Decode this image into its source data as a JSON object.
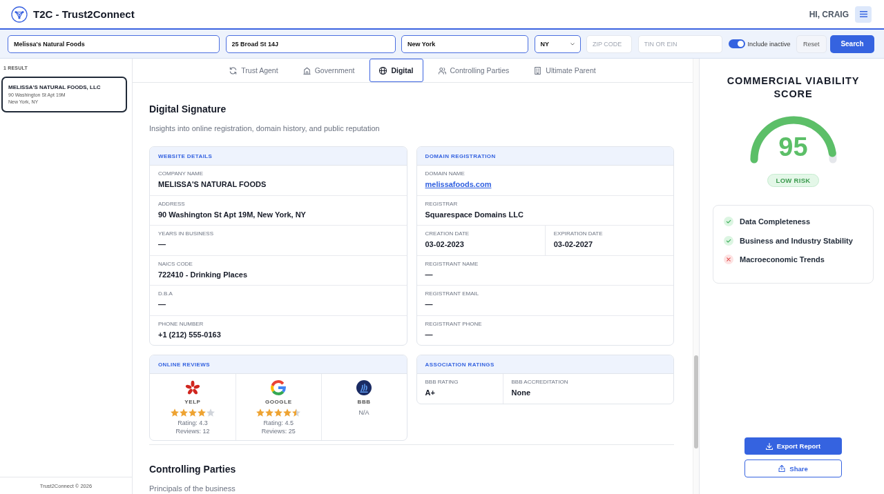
{
  "header": {
    "title": "T2C - Trust2Connect",
    "greeting": "HI, CRAIG"
  },
  "search_bar": {
    "fields": [
      {
        "kind": "text",
        "value": "Melissa's Natural Foods"
      },
      {
        "kind": "text",
        "value": "25 Broad St 14J"
      },
      {
        "kind": "text",
        "value": "New York"
      },
      {
        "kind": "select",
        "value": "NY"
      },
      {
        "kind": "text",
        "placeholder": "ZIP CODE"
      },
      {
        "kind": "text",
        "placeholder": "TIN OR EIN"
      }
    ],
    "include_inactive": {
      "label": "Include inactive",
      "on": true
    },
    "buttons": [
      "Reset",
      "Search"
    ]
  },
  "results": {
    "count": "1 RESULT",
    "items": [
      {
        "name": "MELISSA'S NATURAL FOODS, LLC",
        "address": "90 Washington St Apt 19M",
        "city": "New York, NY",
        "selected": true
      }
    ]
  },
  "footer": "Trust2Connect © 2026",
  "tabs": [
    {
      "label": "Trust Agent",
      "selected": false
    },
    {
      "label": "Government",
      "selected": false
    },
    {
      "label": "Digital",
      "selected": true
    },
    {
      "label": "Controlling Parties",
      "selected": false
    },
    {
      "label": "Ultimate Parent",
      "selected": false
    }
  ],
  "digital_signature": {
    "title": "Digital Signature",
    "subtitle": "Insights into online registration, domain history, and public reputation",
    "website_details": {
      "title": "WEBSITE DETAILS",
      "rows": [
        [
          {
            "kind": "text",
            "label": "COMPANY NAME",
            "value": "MELISSA'S NATURAL FOODS"
          }
        ],
        [
          {
            "kind": "text",
            "label": "ADDRESS",
            "value": "90 Washington St Apt 19M, New York, NY"
          }
        ],
        [
          {
            "kind": "text",
            "label": "YEARS IN BUSINESS",
            "value": "—"
          }
        ],
        [
          {
            "kind": "text",
            "label": "NAICS CODE",
            "value": "722410 - Drinking Places"
          }
        ],
        [
          {
            "kind": "text",
            "label": "D.B.A",
            "value": "—"
          }
        ],
        [
          {
            "kind": "text",
            "label": "PHONE NUMBER",
            "value": "+1 (212) 555-0163"
          }
        ]
      ]
    },
    "domain_registration": {
      "title": "DOMAIN REGISTRATION",
      "rows": [
        [
          {
            "kind": "link",
            "label": "DOMAIN NAME",
            "value": "melissafoods.com"
          }
        ],
        [
          {
            "kind": "text",
            "label": "REGISTRAR",
            "value": "Squarespace Domains LLC"
          }
        ],
        [
          {
            "kind": "text",
            "label": "CREATION DATE",
            "value": "03-02-2023"
          },
          {
            "kind": "text",
            "label": "EXPIRATION DATE",
            "value": "03-02-2027"
          }
        ],
        [
          {
            "kind": "text",
            "label": "REGISTRANT NAME",
            "value": "—"
          }
        ],
        [
          {
            "kind": "text",
            "label": "REGISTRANT EMAIL",
            "value": "—"
          }
        ],
        [
          {
            "kind": "text",
            "label": "REGISTRANT PHONE",
            "value": "—"
          }
        ]
      ]
    },
    "online_reviews": {
      "title": "ONLINE REVIEWS",
      "sources": [
        {
          "name": "YELP",
          "stars": 4,
          "rating": "Rating: 4.3",
          "reviews": "Reviews: 12"
        },
        {
          "name": "GOOGLE",
          "stars": 4.5,
          "rating": "Rating: 4.5",
          "reviews": "Reviews: 25"
        },
        {
          "name": "BBB",
          "note": "N/A"
        }
      ]
    },
    "association_ratings": {
      "title": "ASSOCIATION RATINGS",
      "fields": [
        {
          "kind": "text",
          "label": "BBB RATING",
          "value": "A+"
        },
        {
          "kind": "text",
          "label": "BBB ACCREDITATION",
          "value": "None"
        }
      ]
    }
  },
  "controlling_parties": {
    "title": "Controlling Parties",
    "subtitle": "Principals of the business"
  },
  "score_panel": {
    "title": "COMMERCIAL VIABILITY SCORE",
    "score": "95",
    "level": 0.95,
    "risk": "LOW RISK",
    "factors": [
      {
        "label": "Data Completeness",
        "passed": true
      },
      {
        "label": "Business and Industry Stability",
        "passed": true
      },
      {
        "label": "Macroeconomic Trends",
        "passed": false
      }
    ],
    "buttons": [
      "Export Report",
      "Share"
    ]
  }
}
